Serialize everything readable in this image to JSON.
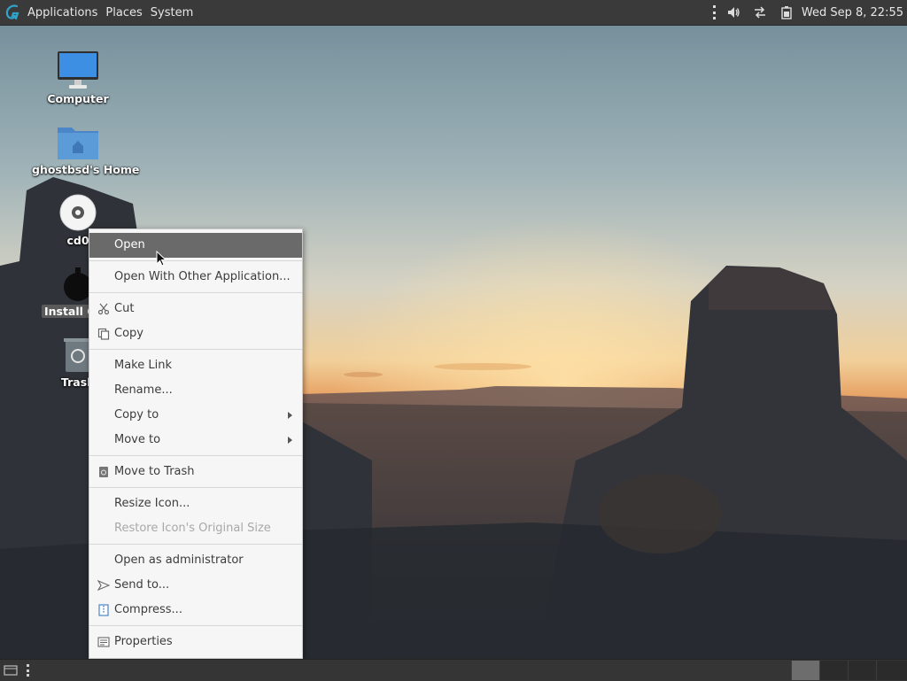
{
  "top_panel": {
    "menus": [
      "Applications",
      "Places",
      "System"
    ],
    "clock": "Wed Sep  8, 22:55",
    "tray_icons": [
      "volume-icon",
      "network-icon",
      "battery-icon"
    ]
  },
  "desktop": {
    "icons": [
      {
        "label": "Computer",
        "icon": "computer-icon"
      },
      {
        "label": "ghostbsd's Home",
        "icon": "home-folder-icon"
      },
      {
        "label": "cd0",
        "icon": "optical-disc-icon"
      },
      {
        "label": "Install Gho",
        "icon": "installer-icon",
        "selected": true
      },
      {
        "label": "Trash",
        "icon": "trash-icon"
      }
    ]
  },
  "context_menu": {
    "open": "Open",
    "open_with": "Open With Other Application...",
    "cut": "Cut",
    "copy": "Copy",
    "make_link": "Make Link",
    "rename": "Rename...",
    "copy_to": "Copy to",
    "move_to": "Move to",
    "move_to_trash": "Move to Trash",
    "resize_icon": "Resize Icon...",
    "restore_size": "Restore Icon's Original Size",
    "open_as_admin": "Open as administrator",
    "send_to": "Send to...",
    "compress": "Compress...",
    "properties": "Properties"
  },
  "colors": {
    "panel": "#3a3a3a",
    "menu_highlight": "#6a6a6a",
    "folder_blue": "#5b9bd8"
  }
}
